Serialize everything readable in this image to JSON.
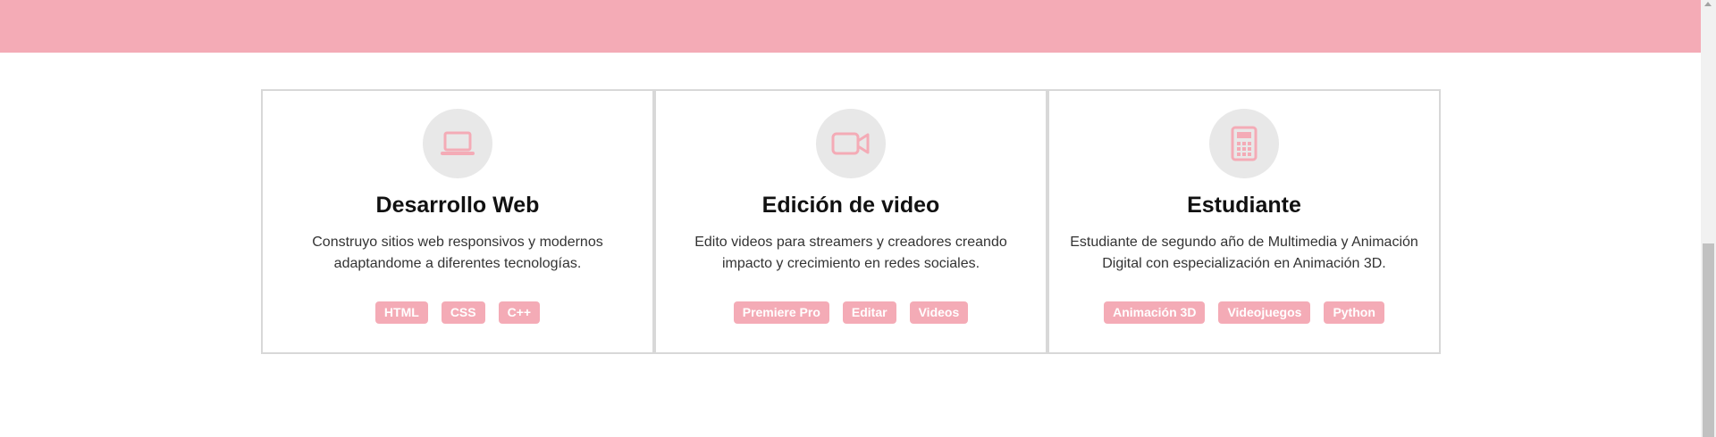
{
  "colors": {
    "accent": "#f4abb6",
    "icon_bg": "#e8e8e8",
    "border": "#d8d8d8"
  },
  "cards": [
    {
      "icon": "laptop-icon",
      "title": "Desarrollo Web",
      "description": "Construyo sitios web responsivos y modernos adaptandome a diferentes tecnologías.",
      "tags": [
        "HTML",
        "CSS",
        "C++"
      ]
    },
    {
      "icon": "video-camera-icon",
      "title": "Edición de video",
      "description": "Edito videos para streamers y creadores creando impacto y crecimiento en redes sociales.",
      "tags": [
        "Premiere Pro",
        "Editar",
        "Videos"
      ]
    },
    {
      "icon": "calculator-icon",
      "title": "Estudiante",
      "description": "Estudiante de segundo año de Multimedia y Animación Digital con especialización en Animación 3D.",
      "tags": [
        "Animación 3D",
        "Videojuegos",
        "Python"
      ]
    }
  ]
}
